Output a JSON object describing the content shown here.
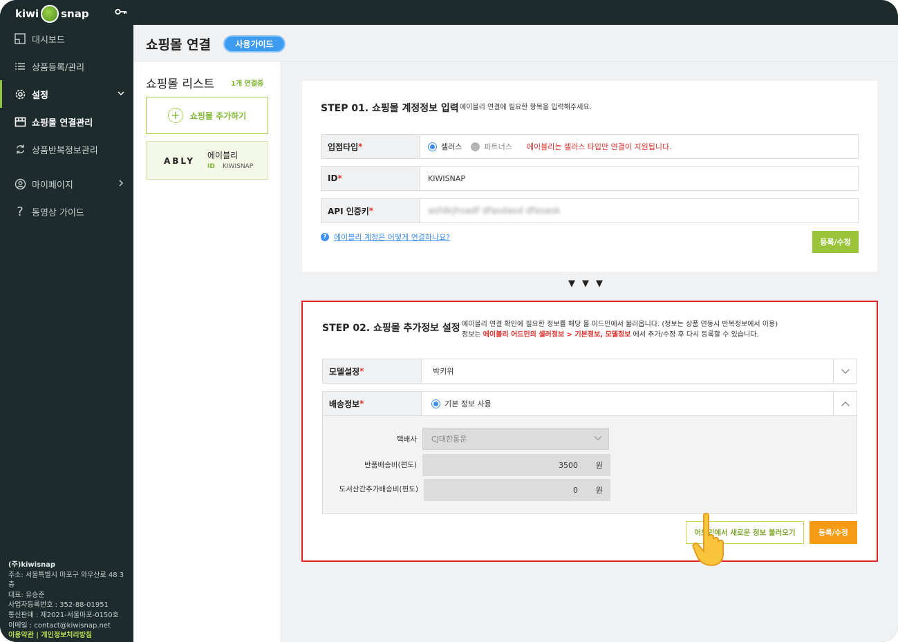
{
  "brand": {
    "logo_left": "kiwi",
    "logo_right": "snap"
  },
  "sidebar": {
    "items": [
      {
        "label": "대시보드",
        "icon": "dashboard-icon"
      },
      {
        "label": "상품등록/관리",
        "icon": "list-icon"
      },
      {
        "label": "설정",
        "icon": "gear-icon"
      },
      {
        "label": "쇼핑몰 연결관리",
        "icon": "store-icon"
      },
      {
        "label": "상품반복정보관리",
        "icon": "refresh-icon"
      },
      {
        "label": "마이페이지",
        "icon": "user-icon"
      },
      {
        "label": "동영상 가이드",
        "icon": "question-icon"
      }
    ],
    "footer": {
      "company": "(주)kiwisnap",
      "address": "주소: 서울특별시 마포구 와우산로 48 3층",
      "ceo": "대표: 유승준",
      "biz_no": "사업자등록번호 : 352-88-01951",
      "ecommerce": "통신판매 : 제2021-서울마포-0150호",
      "email": "이메일 : contact@kiwisnap.net",
      "links": "이용약관 | 개인정보처리방침"
    }
  },
  "header": {
    "title": "쇼핑몰 연결",
    "guide_button": "사용가이드"
  },
  "mall_list": {
    "title": "쇼핑몰 리스트",
    "count": "1개 연결중",
    "add_button": "쇼핑몰 추가하기",
    "items": [
      {
        "logo": "ABLY",
        "name": "에이블리",
        "id_label": "ID",
        "id": "KIWISNAP"
      }
    ]
  },
  "step1": {
    "title": "STEP 01. 쇼핑몰 계정정보 입력",
    "desc": "에이블리 연결에 필요한 항목을 입력해주세요.",
    "type_label": "입점타입",
    "type_options": [
      "셀러스",
      "파트너스"
    ],
    "type_warning": "에이블리는 셀러스 타입만 연결이 지원됩니다.",
    "id_label": "ID",
    "id_value": "KIWISNAP",
    "api_label": "API 인증키",
    "api_value": "asfdkjhsadf dfasdasd dfasask",
    "help_link": "에이블리 계정은 어떻게 연결하나요?",
    "submit": "등록/수정"
  },
  "arrows": "▼▼▼",
  "step2": {
    "title": "STEP 02. 쇼핑몰 추가정보 설정",
    "desc_line1": "에이블리 연결 확인에 필요한 정보를 해당 몰 어드민에서 불러옵니다. (정보는 상품 연동시 반복정보에서 이용)",
    "desc_line2_pre": "정보는 ",
    "desc_line2_highlight": "에이블리 어드민의 셀러정보 > 기본정보, 모델정보",
    "desc_line2_post": " 에서 추가/수정 후 다시 등록할 수 있습니다.",
    "model_label": "모델설정",
    "model_value": "박키위",
    "delivery_label": "배송정보",
    "delivery_option": "기본 정보 사용",
    "courier_label": "택배사",
    "courier_value": "CJ대한통운",
    "return_fee_label": "반품배송비(편도)",
    "return_fee": "3500",
    "island_fee_label": "도서산간추가배송비(편도)",
    "island_fee": "0",
    "unit": "원",
    "load_button": "어드민에서 새로운 정보 불러오기",
    "submit": "등록/수정"
  },
  "colors": {
    "sidebar_bg": "#1d2b2d",
    "accent_green": "#9ac53a",
    "accent_blue": "#3d9bf0",
    "highlight_red": "#e0242a",
    "orange": "#f79a14"
  }
}
